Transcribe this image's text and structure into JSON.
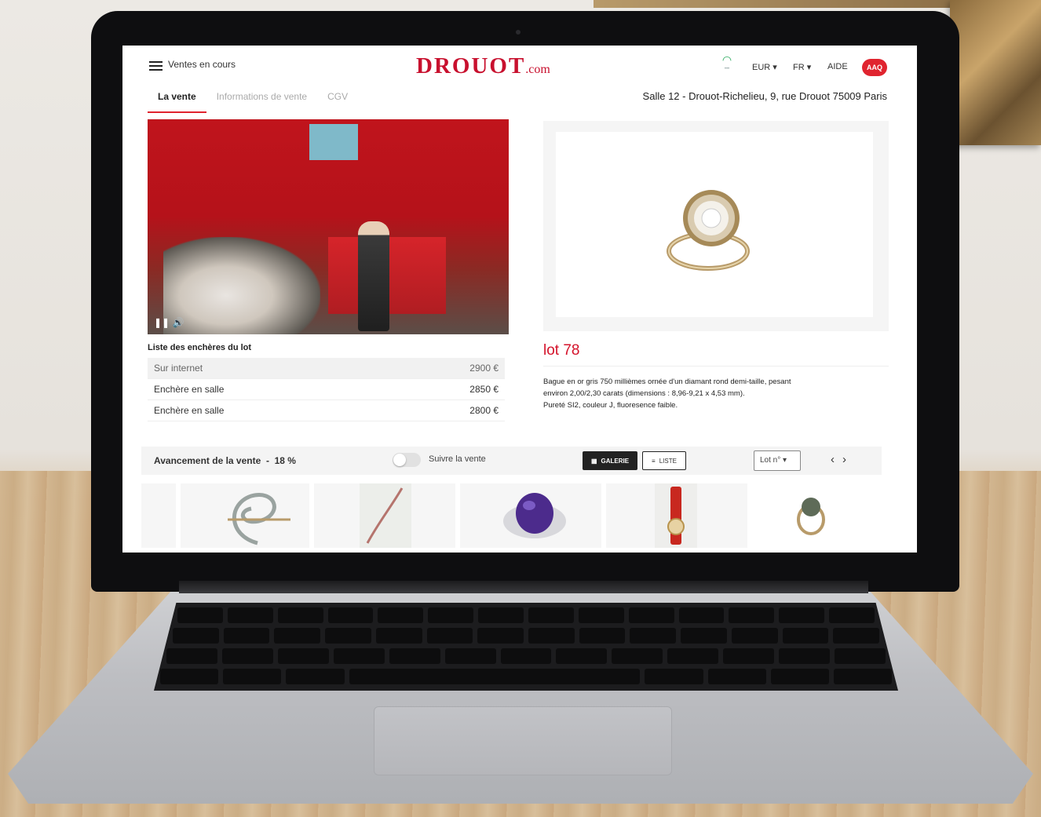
{
  "header": {
    "menu_label": "Ventes en cours",
    "logo_main": "DROUOT",
    "logo_suffix": ".com",
    "currency": "EUR",
    "language": "FR",
    "help": "AIDE",
    "user_badge": "AAQ"
  },
  "tabs": [
    {
      "label": "La vente",
      "active": true
    },
    {
      "label": "Informations de vente",
      "active": false
    },
    {
      "label": "CGV",
      "active": false
    }
  ],
  "location": "Salle 12 - Drouot-Richelieu, 9, rue Drouot 75009 Paris",
  "bids": {
    "title": "Liste des enchères du lot",
    "rows": [
      {
        "source": "Sur internet",
        "amount": "2900 €"
      },
      {
        "source": "Enchère en salle",
        "amount": "2850 €"
      },
      {
        "source": "Enchère en salle",
        "amount": "2800 €"
      }
    ]
  },
  "lot": {
    "title": "lot 78",
    "description": [
      "Bague en or gris 750 millièmes ornée d'un diamant rond demi-taille, pesant",
      "environ 2,00/2,30 carats (dimensions : 8,96-9,21 x 4,53 mm).",
      "Pureté SI2, couleur J, fluoresence faible."
    ]
  },
  "progress": {
    "label": "Avancement de la vente",
    "separator": "-",
    "percent_text": "18 %",
    "percent": 18
  },
  "follow": {
    "label": "Suivre la vente",
    "enabled": false
  },
  "view": {
    "gallery": "GALERIE",
    "list": "LISTE",
    "lot_select": "Lot n°"
  },
  "colors": {
    "brand_red": "#c8102e",
    "accent_red": "#e0242f",
    "wifi_green": "#25a85a"
  },
  "icons": [
    "menu-icon",
    "wifi-icon",
    "pause-icon",
    "volume-icon",
    "grid-icon",
    "list-icon",
    "chevron-left-icon",
    "chevron-right-icon"
  ]
}
